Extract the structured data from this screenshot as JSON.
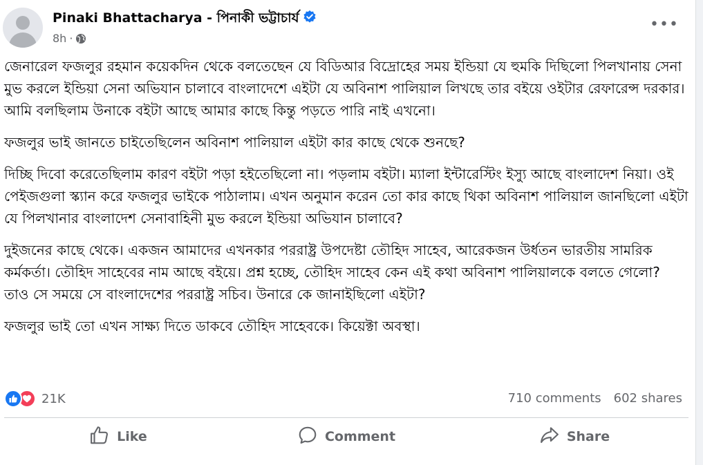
{
  "post": {
    "author": "Pinaki Bhattacharya - পিনাকী ভট্টাচার্য",
    "time": "8h",
    "privacy_icon": "globe-icon",
    "more_label": "•••",
    "paragraphs": [
      "জেনারেল ফজলুর রহমান কয়েকদিন থেকে বলতেছেন যে বিডিআর বিদ্রোহের সময় ইন্ডিয়া যে হুমকি দিছিলো পিলখানায় সেনা মুভ করলে ইন্ডিয়া সেনা অভিযান চালাবে বাংলাদেশে এইটা যে অবিনাশ পালিয়াল লিখছে তার বইয়ে ওইটার রেফারেন্স দরকার। আমি বলছিলাম উনাকে বইটা আছে আমার কাছে কিন্তু পড়তে পারি নাই এখনো।",
      "ফজলুর ভাই জানতে চাইতেছিলেন অবিনাশ পালিয়াল এইটা কার কাছে থেকে শুনছে?",
      "দিচ্ছি দিবো করেতেছিলাম কারণ বইটা পড়া হইতেছিলো না। পড়লাম বইটা। ম্যালা ইন্টারেস্টিং ইস্যু আছে বাংলাদেশ নিয়া। ওই পেইজগুলা স্ক্যান করে ফজলুর ভাইকে পাঠালাম। এখন অনুমান করেন তো কার কাছে থিকা অবিনাশ পালিয়াল জানছিলো এইটা যে পিলখানার বাংলাদেশ সেনাবাহিনী মুভ করলে ইন্ডিয়া অভিযান চালাবে?",
      "দুইজনের কাছে থেকে। একজন আমাদের এখনকার পররাষ্ট্র উপদেষ্টা তৌহিদ সাহেব, আরেকজন উর্ধতন ভারতীয় সামরিক কর্মকর্তা। তৌহিদ সাহেবের নাম আছে বইয়ে। প্রশ্ন হচ্ছে, তৌহিদ সাহেব কেন এই কথা অবিনাশ পালিয়ালকে বলতে গেলো? তাও সে সময়ে সে বাংলাদেশের পররাষ্ট্র সচিব। উনারে কে জানাইছিলো এইটা?",
      "ফজলুর ভাই তো এখন সাক্ষ্য দিতে ডাকবে তৌহিদ সাহেবকে। কিয়েক্টা অবস্থা।"
    ],
    "reaction_count": "21K",
    "comments": "710 comments",
    "shares": "602 shares",
    "actions": {
      "like": "Like",
      "comment": "Comment",
      "share": "Share"
    },
    "colors": {
      "link_blue": "#1877f2",
      "love_red": "#f33e58",
      "secondary_text": "#65676b"
    }
  }
}
